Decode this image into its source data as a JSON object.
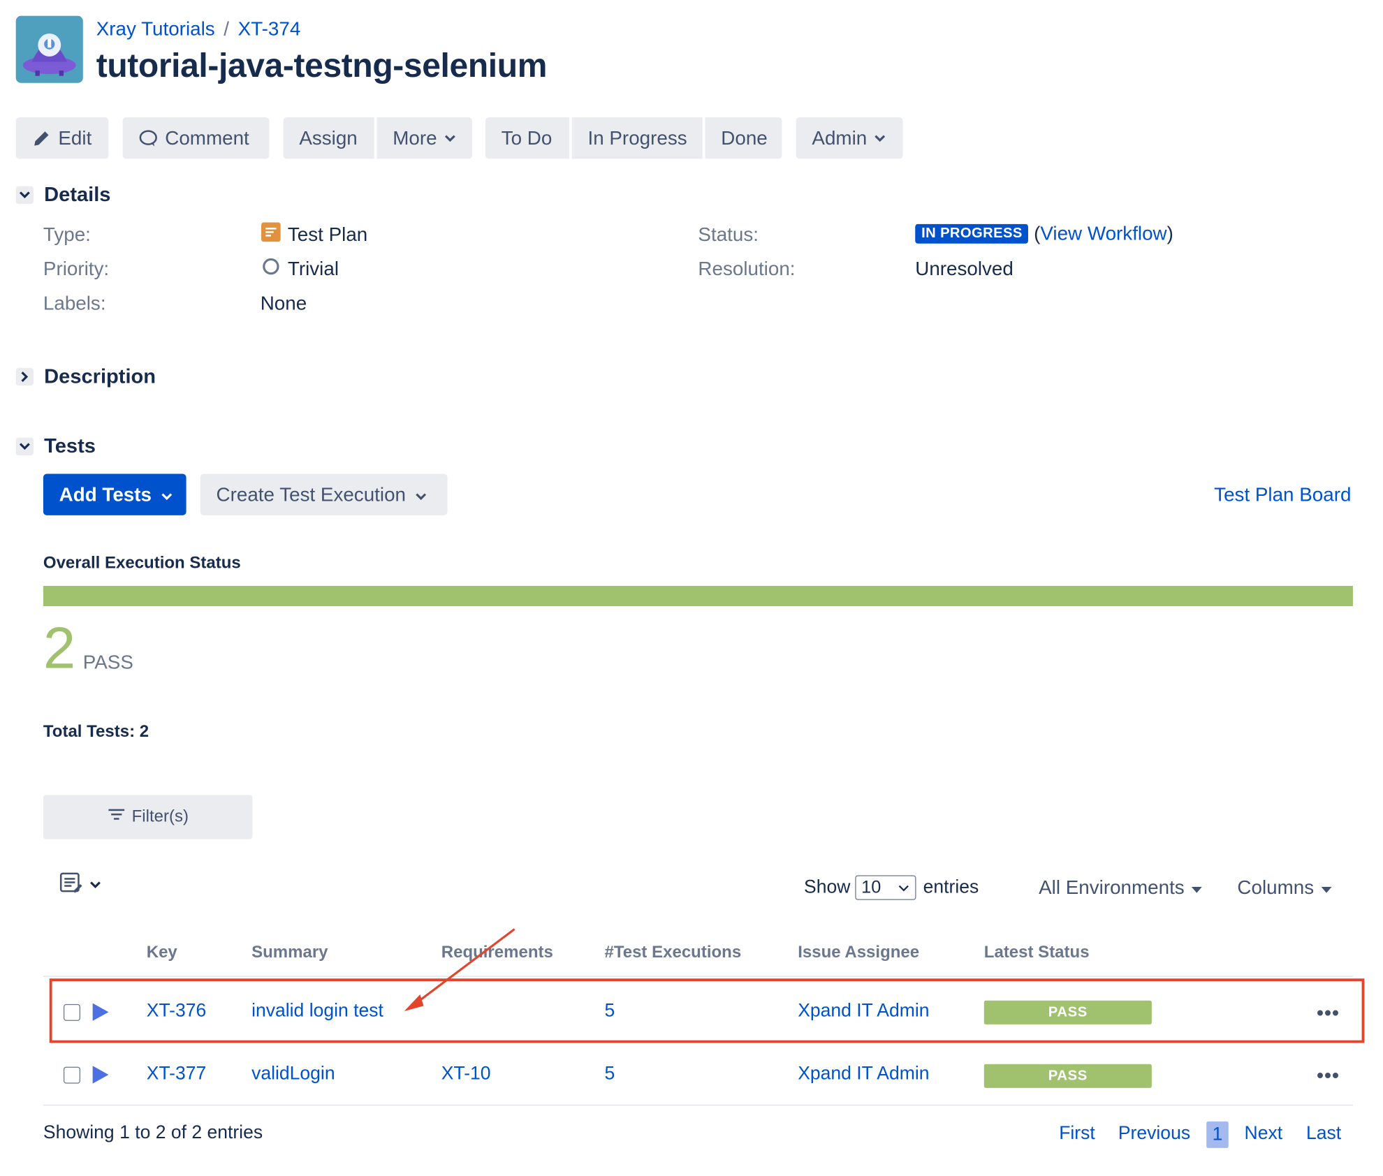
{
  "header": {
    "project": "Xray Tutorials",
    "separator": "/",
    "issue_key": "XT-374",
    "title": "tutorial-java-testng-selenium"
  },
  "toolbar": {
    "edit": "Edit",
    "comment": "Comment",
    "assign": "Assign",
    "more": "More",
    "todo": "To Do",
    "in_progress": "In Progress",
    "done": "Done",
    "admin": "Admin"
  },
  "details": {
    "heading": "Details",
    "type_label": "Type:",
    "type_value": "Test Plan",
    "priority_label": "Priority:",
    "priority_value": "Trivial",
    "labels_label": "Labels:",
    "labels_value": "None",
    "status_label": "Status:",
    "status_value": "IN PROGRESS",
    "view_workflow_open": "(",
    "view_workflow": "View Workflow",
    "view_workflow_close": ")",
    "resolution_label": "Resolution:",
    "resolution_value": "Unresolved"
  },
  "description": {
    "heading": "Description"
  },
  "tests": {
    "heading": "Tests",
    "add_tests": "Add Tests",
    "create_execution": "Create Test Execution",
    "board_link": "Test Plan Board",
    "overall_heading": "Overall Execution Status",
    "pass_count": "2",
    "pass_label": "PASS",
    "pass_fraction": 1.0,
    "total": "Total Tests: 2",
    "filters": "Filter(s)",
    "show": "Show",
    "page_size": "10",
    "entries": "entries",
    "environments": "All Environments",
    "columns": "Columns"
  },
  "table": {
    "headers": [
      "Key",
      "Summary",
      "Requirements",
      "#Test Executions",
      "Issue Assignee",
      "Latest Status"
    ],
    "rows": [
      {
        "key": "XT-376",
        "summary": "invalid login test",
        "requirements": "",
        "executions": "5",
        "assignee": "Xpand IT Admin",
        "status": "PASS",
        "actions": "•••"
      },
      {
        "key": "XT-377",
        "summary": "validLogin",
        "requirements": "XT-10",
        "executions": "5",
        "assignee": "Xpand IT Admin",
        "status": "PASS",
        "actions": "•••"
      }
    ]
  },
  "footer": {
    "showing": "Showing 1 to 2 of 2 entries",
    "first": "First",
    "previous": "Previous",
    "current_page": "1",
    "next": "Next",
    "last": "Last"
  },
  "colors": {
    "brand": "#0052cc",
    "pass": "#a0c16e",
    "highlight": "#e2452c"
  },
  "icons": [
    "xray-logo-icon",
    "pencil-icon",
    "comment-icon",
    "chevron-down-icon",
    "test-plan-icon",
    "trivial-priority-icon",
    "filter-icon",
    "list-edit-icon",
    "test-run-icon"
  ]
}
